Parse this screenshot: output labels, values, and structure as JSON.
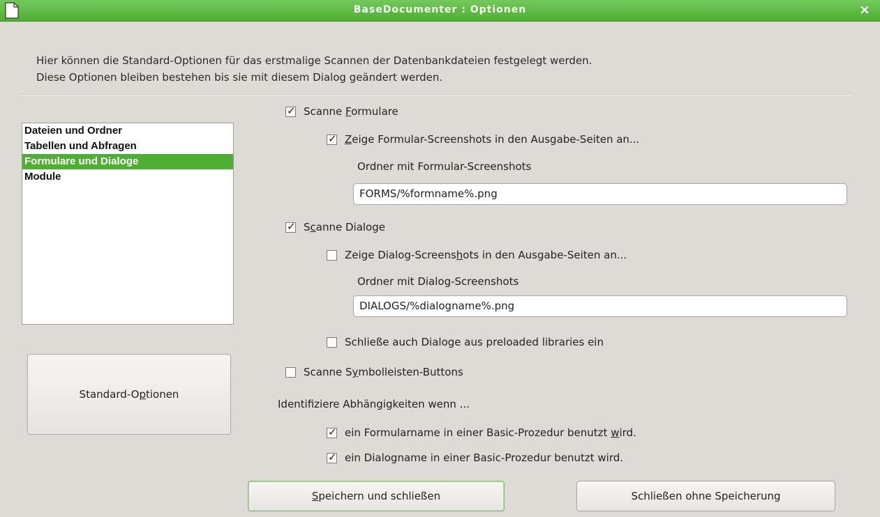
{
  "window": {
    "title": "BaseDocumenter : Optionen",
    "close": "×",
    "accent": "#4fae33"
  },
  "intro": {
    "line1": "Hier können die Standard-Optionen für das erstmalige Scannen der Datenbankdateien festgelegt werden.",
    "line2": "Diese Optionen bleiben bestehen bis sie mit diesem Dialog geändert werden."
  },
  "categories": {
    "items": [
      "Dateien und Ordner",
      "Tabellen und Abfragen",
      "Formulare und Dialoge",
      "Module"
    ],
    "selected": "Formulare und Dialoge"
  },
  "standard_button": {
    "pre": "Standard-O",
    "mnemonic": "p",
    "post": "tionen"
  },
  "options": {
    "scan_forms": {
      "checked": true,
      "pre": "Scanne ",
      "mnemonic": "F",
      "post": "ormulare"
    },
    "show_form_screenshots": {
      "checked": true,
      "pre": "",
      "mnemonic": "Z",
      "post": "eige Formular-Screenshots in den Ausgabe-Seiten an..."
    },
    "form_folder_label": "Ordner mit Formular-Screenshots",
    "form_folder_value": "FORMS/%formname%.png",
    "scan_dialogs": {
      "checked": true,
      "pre": "S",
      "mnemonic": "c",
      "post": "anne Dialoge"
    },
    "show_dialog_screenshots": {
      "checked": false,
      "pre": "Zeige Dialog-Screens",
      "mnemonic": "h",
      "post": "ots in den Ausgabe-Seiten an..."
    },
    "dialog_folder_label": "Ordner mit Dialog-Screenshots",
    "dialog_folder_value": "DIALOGS/%dialogname%.png",
    "include_preloaded": {
      "checked": false,
      "text": "Schließe auch Dialoge aus preloaded libraries ein"
    },
    "scan_toolbar_buttons": {
      "checked": false,
      "pre": "Scanne S",
      "mnemonic": "y",
      "post": "mbolleisten-Buttons"
    },
    "dependencies_label": "Identifiziere Abhängigkeiten wenn ...",
    "dep_form_name": {
      "checked": true,
      "pre": "ein Formularname in einer Basic-Prozedur benutzt ",
      "mnemonic": "w",
      "post": "ird."
    },
    "dep_dialog_name": {
      "checked": true,
      "text": "ein Dialogname in einer Basic-Prozedur benutzt wird."
    }
  },
  "buttons": {
    "save_close": {
      "pre": "",
      "mnemonic": "S",
      "post": "peichern und schließen"
    },
    "close_no_save": "Schließen ohne Speicherung"
  }
}
